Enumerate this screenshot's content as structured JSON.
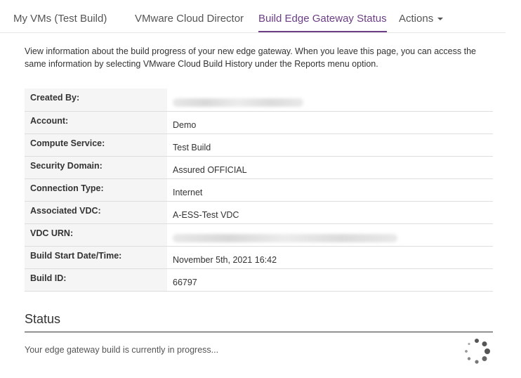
{
  "tabs": [
    {
      "label": "My VMs (Test Build)",
      "active": false
    },
    {
      "label": "VMware Cloud Director",
      "active": false
    },
    {
      "label": "Build Edge Gateway Status",
      "active": true
    },
    {
      "label": "Actions",
      "active": false,
      "has_dropdown": true
    }
  ],
  "intro": {
    "text": "View information about the build progress of your new edge gateway. When you leave this page, you can access the same information by selecting VMware Cloud Build History under the Reports menu option."
  },
  "details": {
    "rows": [
      {
        "label": "Created By:",
        "value": "",
        "redacted": true
      },
      {
        "label": "Account:",
        "value": "Demo"
      },
      {
        "label": "Compute Service:",
        "value": "Test Build"
      },
      {
        "label": "Security Domain:",
        "value": "Assured OFFICIAL"
      },
      {
        "label": "Connection Type:",
        "value": "Internet"
      },
      {
        "label": "Associated VDC:",
        "value": "A-ESS-Test VDC"
      },
      {
        "label": "VDC URN:",
        "value": "",
        "redacted": true
      },
      {
        "label": "Build Start Date/Time:",
        "value": "November 5th, 2021 16:42"
      },
      {
        "label": "Build ID:",
        "value": "66797"
      }
    ]
  },
  "status": {
    "heading": "Status",
    "message": "Your edge gateway build is currently in progress...",
    "spinner_icon": "loading-spinner-icon"
  },
  "colors": {
    "accent": "#6b3e86",
    "label_bg": "#f5f5f5",
    "border": "#dddddd"
  }
}
